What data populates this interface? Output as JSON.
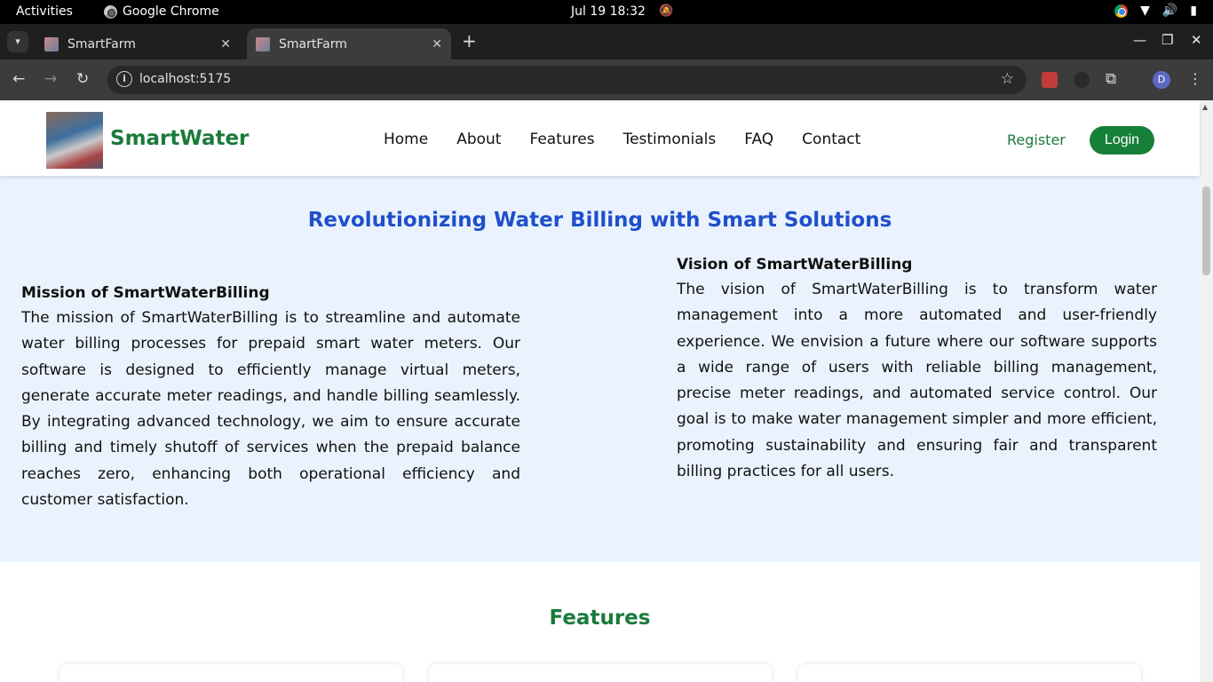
{
  "os": {
    "activities": "Activities",
    "app_name": "Google Chrome",
    "clock": "Jul 19  18:32"
  },
  "browser": {
    "tabs": [
      {
        "title": "SmartFarm",
        "active": false
      },
      {
        "title": "SmartFarm",
        "active": true
      }
    ],
    "url": "localhost:5175",
    "profile_initial": "D"
  },
  "site": {
    "brand": "SmartWater",
    "nav": [
      "Home",
      "About",
      "Features",
      "Testimonials",
      "FAQ",
      "Contact"
    ],
    "register": "Register",
    "login": "Login",
    "colors": {
      "brand_green": "#1a7a3a",
      "title_blue": "#1f4fcc",
      "section_bg": "#eaf3fd"
    }
  },
  "about": {
    "title": "Revolutionizing Water Billing with Smart Solutions",
    "mission_heading": "Mission of SmartWaterBilling",
    "mission_text": "The mission of SmartWaterBilling is to streamline and automate water billing processes for prepaid smart water meters. Our software is designed to efficiently manage virtual meters, generate accurate meter readings, and handle billing seamlessly. By integrating advanced technology, we aim to ensure accurate billing and timely shutoff of services when the prepaid balance reaches zero, enhancing both operational efficiency and customer satisfaction.",
    "vision_heading": "Vision of SmartWaterBilling",
    "vision_text": "The vision of SmartWaterBilling is to transform water management into a more automated and user-friendly experience. We envision a future where our software supports a wide range of users with reliable billing management, precise meter readings, and automated service control. Our goal is to make water management simpler and more efficient, promoting sustainability and ensuring fair and transparent billing practices for all users."
  },
  "features": {
    "title": "Features"
  }
}
